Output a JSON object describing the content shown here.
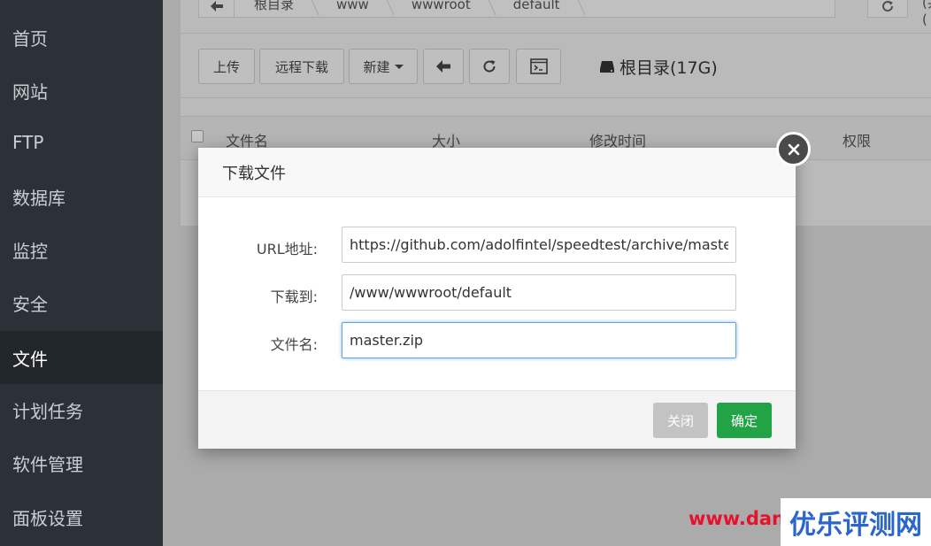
{
  "sidebar": {
    "items": [
      {
        "label": "首页"
      },
      {
        "label": "网站"
      },
      {
        "label": "FTP"
      },
      {
        "label": "数据库"
      },
      {
        "label": "监控"
      },
      {
        "label": "安全"
      },
      {
        "label": "文件"
      },
      {
        "label": "计划任务"
      },
      {
        "label": "软件管理"
      },
      {
        "label": "面板设置"
      }
    ],
    "active": "文件"
  },
  "breadcrumb": {
    "items": [
      "根目录",
      "www",
      "wwwroot",
      "default"
    ],
    "cut_text": "(共("
  },
  "toolbar": {
    "upload_label": "上传",
    "remote_download_label": "远程下载",
    "new_label": "新建",
    "disk_label": "根目录(17G)"
  },
  "table": {
    "headers": {
      "name": "文件名",
      "size": "大小",
      "modified": "修改时间",
      "perm": "权限"
    }
  },
  "dialog": {
    "title": "下载文件",
    "url_label": "URL地址:",
    "url_value": "https://github.com/adolfintel/speedtest/archive/master.zip",
    "dest_label": "下载到:",
    "dest_value": "/www/wwwroot/default",
    "filename_label": "文件名:",
    "filename_value": "master.zip",
    "close_label": "关闭",
    "ok_label": "确定"
  },
  "watermark": {
    "url_text": "www.dan",
    "brand_text": "优乐评测网"
  },
  "colors": {
    "sidebar_bg": "#2b3137",
    "confirm_green": "#22a345",
    "watermark_red": "#e8112d",
    "watermark_blue": "#2b66c9"
  }
}
